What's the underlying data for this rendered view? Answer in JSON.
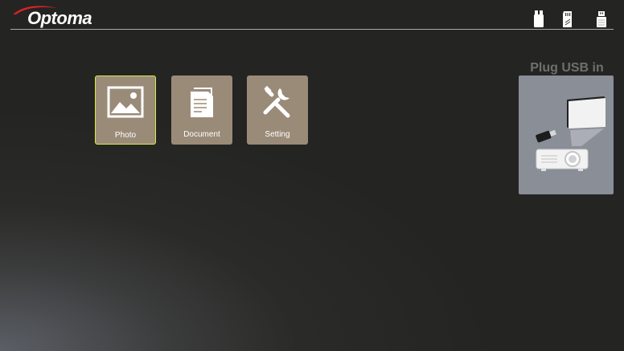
{
  "brand": {
    "name": "Optoma",
    "accent": "#d9222a"
  },
  "status_icons": [
    {
      "icon": "usb-drive-icon"
    },
    {
      "icon": "sd-card-icon"
    },
    {
      "icon": "usb-stick-icon"
    }
  ],
  "menu": {
    "items": [
      {
        "label": "Photo",
        "icon": "photo-icon",
        "selected": true
      },
      {
        "label": "Document",
        "icon": "document-icon",
        "selected": false
      },
      {
        "label": "Setting",
        "icon": "settings-tools-icon",
        "selected": false
      }
    ],
    "tile_color": "#9a8b78",
    "selection_color": "#d9e84a"
  },
  "plug_panel": {
    "title": "Plug USB in",
    "illustration": "usb-to-projector-illustration"
  }
}
